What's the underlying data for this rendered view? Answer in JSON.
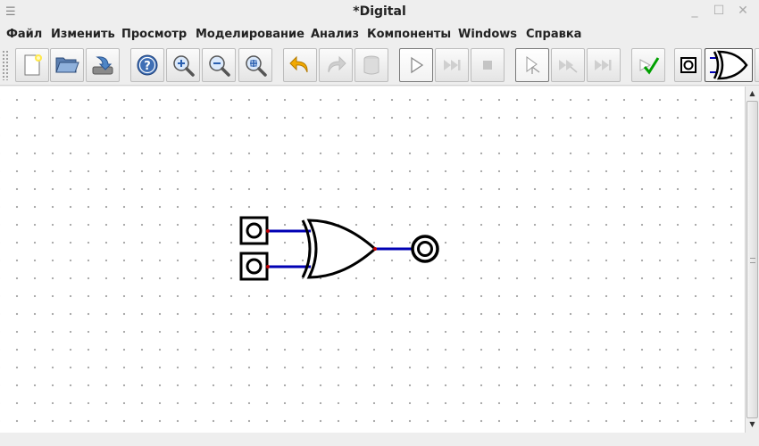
{
  "window": {
    "title": "*Digital"
  },
  "menu": {
    "items": [
      {
        "id": "file",
        "label": "Файл"
      },
      {
        "id": "edit",
        "label": "Изменить"
      },
      {
        "id": "view",
        "label": "Просмотр"
      },
      {
        "id": "simulation",
        "label": "Моделирование"
      },
      {
        "id": "analysis",
        "label": "Анализ"
      },
      {
        "id": "components",
        "label": "Компоненты"
      },
      {
        "id": "windows",
        "label": "Windows"
      },
      {
        "id": "help",
        "label": "Справка"
      }
    ]
  },
  "toolbar": {
    "buttons": [
      {
        "id": "new",
        "icon": "new-file-icon"
      },
      {
        "id": "open",
        "icon": "open-folder-icon"
      },
      {
        "id": "save",
        "icon": "save-icon"
      },
      {
        "id": "help",
        "icon": "help-icon"
      },
      {
        "id": "zoom-in",
        "icon": "zoom-in-icon"
      },
      {
        "id": "zoom-out",
        "icon": "zoom-out-icon"
      },
      {
        "id": "zoom-fit",
        "icon": "zoom-fit-icon"
      },
      {
        "id": "undo",
        "icon": "undo-icon"
      },
      {
        "id": "redo",
        "icon": "redo-icon"
      },
      {
        "id": "delete",
        "icon": "trash-icon"
      },
      {
        "id": "run",
        "icon": "play-icon"
      },
      {
        "id": "step",
        "icon": "fast-forward-icon"
      },
      {
        "id": "stop",
        "icon": "stop-icon"
      },
      {
        "id": "micro-step",
        "icon": "micro-step-icon"
      },
      {
        "id": "run-to-break",
        "icon": "run-to-break-icon"
      },
      {
        "id": "run-to-end",
        "icon": "run-to-end-icon"
      },
      {
        "id": "test",
        "icon": "check-icon"
      },
      {
        "id": "last-output",
        "icon": "output-component-icon"
      },
      {
        "id": "last-xor",
        "icon": "xor-gate-icon"
      }
    ]
  },
  "colors": {
    "wire": "#0000b4",
    "pin": "#c00000",
    "component": "#000000",
    "grid_dot": "#a8a8a8",
    "check": "#00a000",
    "undo": "#f2a900"
  },
  "circuit": {
    "components": [
      "input-a",
      "input-b",
      "xor-gate",
      "output"
    ]
  }
}
